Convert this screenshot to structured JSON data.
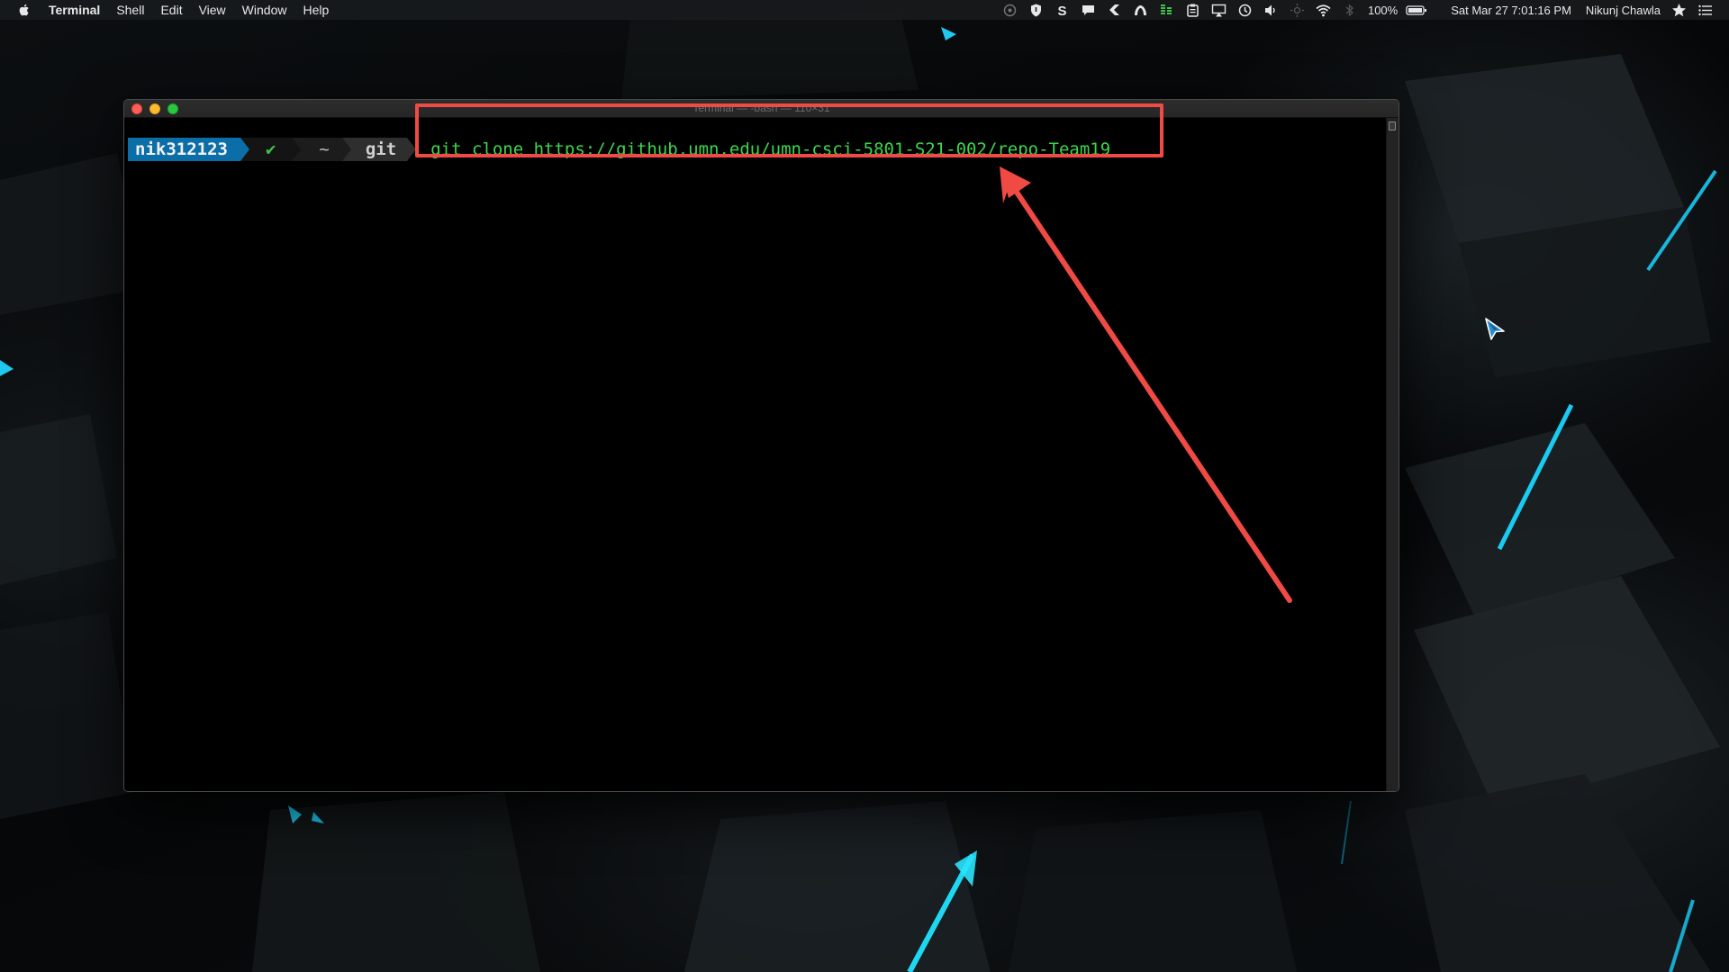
{
  "menubar": {
    "app_name": "Terminal",
    "menus": [
      "Shell",
      "Edit",
      "View",
      "Window",
      "Help"
    ],
    "battery": "100%",
    "datetime": "Sat Mar 27  7:01:16 PM",
    "user": "Nikunj Chawla",
    "status_icons": [
      "fan-icon",
      "shield-icon",
      "s-app-icon",
      "chat-icon",
      "shortcut-icon",
      "wifi-arc-icon",
      "activity-bars-icon",
      "clipboard-icon",
      "airplay-icon",
      "time-machine-icon",
      "volume-icon",
      "brightness-icon",
      "wifi-icon",
      "bluetooth-icon",
      "battery-icon",
      "star-icon",
      "list-icon"
    ]
  },
  "terminal": {
    "window_title": "Terminal — -bash — 110×31",
    "prompt": {
      "user": "nik312123",
      "status": "✔",
      "directory": "~",
      "repo": "git"
    },
    "command": "git clone https://github.umn.edu/umn-csci-5801-S21-002/repo-Team19"
  },
  "colors": {
    "highlight": "#f04a44",
    "command_text": "#3ad84a",
    "user_segment": "#0b6ea8"
  }
}
